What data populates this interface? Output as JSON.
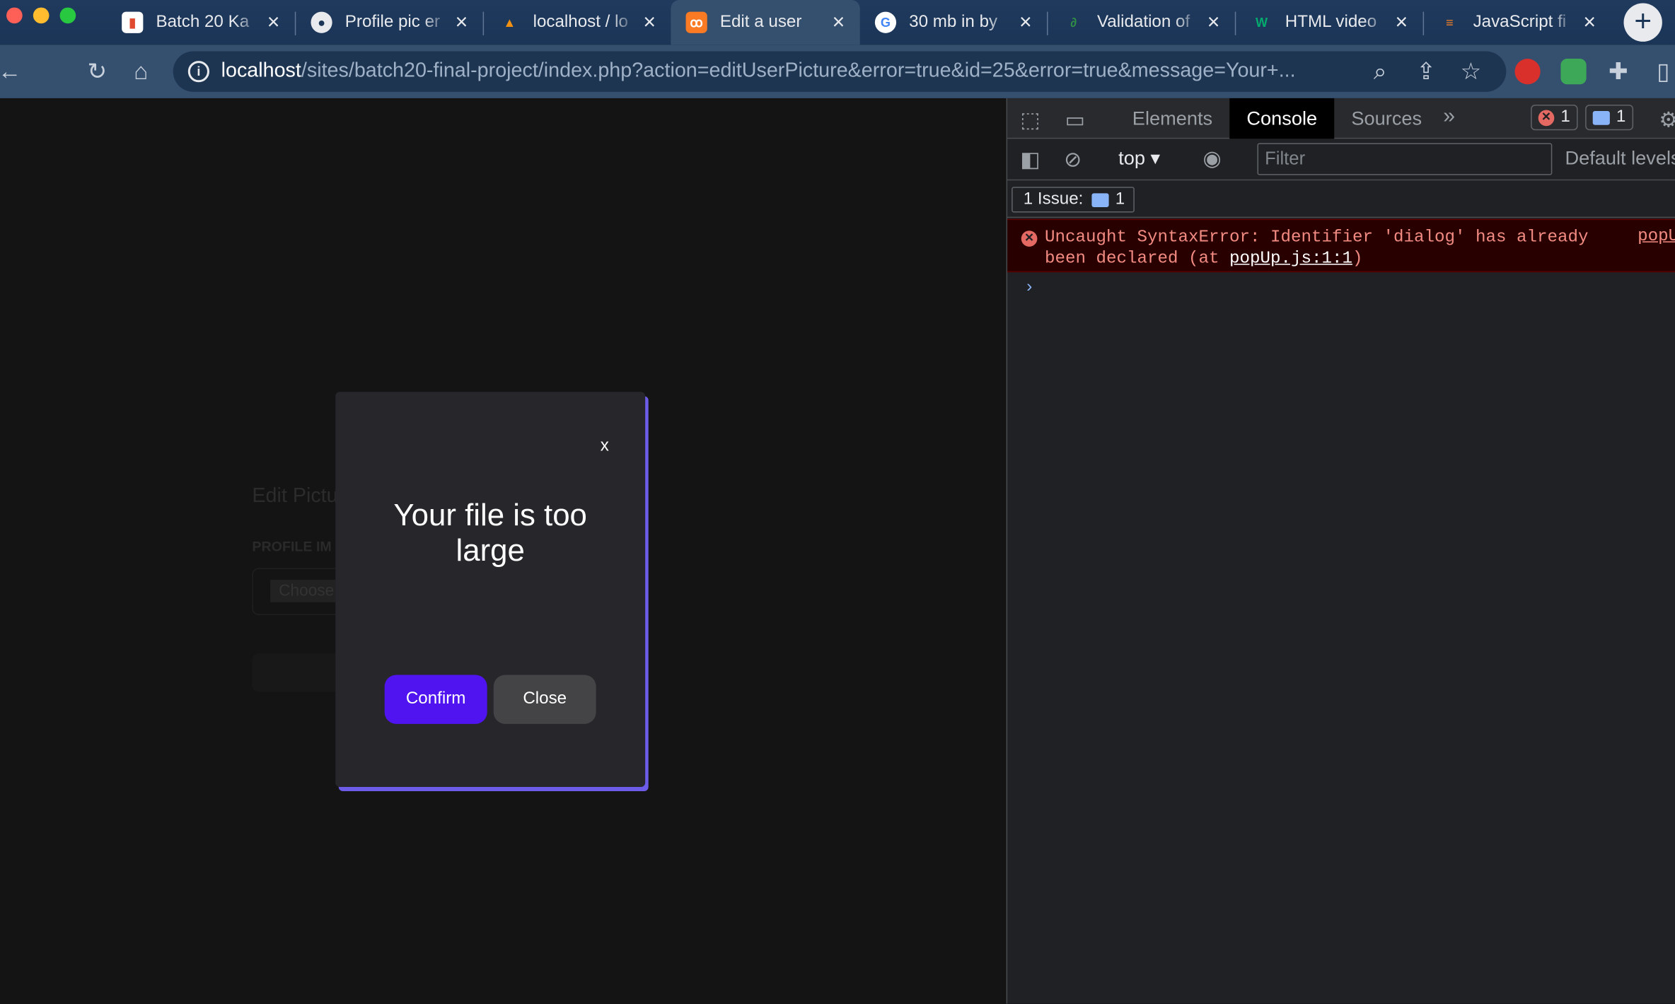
{
  "browser": {
    "tabs": [
      {
        "title": "Batch 20 Ka",
        "icon": "trello-icon",
        "active": false
      },
      {
        "title": "Profile pic er",
        "icon": "github-icon",
        "active": false
      },
      {
        "title": "localhost / lo",
        "icon": "phpmyadmin-icon",
        "active": false
      },
      {
        "title": "Edit a user",
        "icon": "xampp-icon",
        "active": true
      },
      {
        "title": "30 mb in by",
        "icon": "google-icon",
        "active": false
      },
      {
        "title": "Validation of",
        "icon": "geeksforgeeks-icon",
        "active": false
      },
      {
        "title": "HTML video",
        "icon": "w3schools-icon",
        "active": false
      },
      {
        "title": "JavaScript fi",
        "icon": "stackoverflow-icon",
        "active": false
      }
    ],
    "url_host": "localhost",
    "url_path": "/sites/batch20-final-project/index.php?action=editUserPicture&error=true&id=25&error=true&message=Your+..."
  },
  "page": {
    "background_title": "Edit Pictu",
    "background_label": "PROFILE IM",
    "background_file_button": "Choose"
  },
  "modal": {
    "close_x": "x",
    "message": "Your file is too large",
    "confirm_label": "Confirm",
    "close_label": "Close",
    "accent_color": "#6c5ce7",
    "confirm_color": "#4f14f0"
  },
  "devtools": {
    "tabs": [
      "Elements",
      "Console",
      "Sources"
    ],
    "active_tab": "Console",
    "error_count": "1",
    "message_count": "1",
    "context": "top",
    "filter_placeholder": "Filter",
    "levels": "Default levels",
    "issues_label": "1 Issue:",
    "issues_count": "1",
    "error_message": "Uncaught SyntaxError: Identifier 'dialog' has already been declared (at ",
    "error_link": "popUp.js:1:1",
    "error_tail": ")",
    "error_source": "popU",
    "prompt": "›"
  }
}
